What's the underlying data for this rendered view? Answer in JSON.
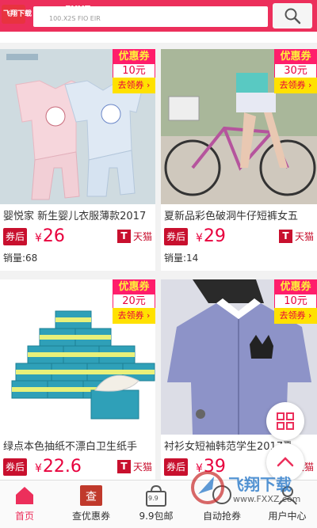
{
  "header": {
    "logo_text": "飞翔下载",
    "site_url": "www.FXXZ.com",
    "search_placeholder": "100.X2S FIO EIR",
    "search_icon": "search-icon"
  },
  "products": [
    {
      "title": "婴悦家 新生婴儿衣服薄款2017",
      "after_coupon_label": "券后",
      "currency": "¥",
      "price": "26",
      "platform": "天猫",
      "platform_icon_letter": "T",
      "sales": "销量:68",
      "coupon": {
        "label": "优惠券",
        "amount": "10元",
        "action": "去领券 ›"
      }
    },
    {
      "title": "夏新品彩色破洞牛仔短裤女五",
      "after_coupon_label": "券后",
      "currency": "¥",
      "price": "29",
      "platform": "天猫",
      "platform_icon_letter": "T",
      "sales": "销量:14",
      "coupon": {
        "label": "优惠券",
        "amount": "30元",
        "action": "去领券 ›"
      }
    },
    {
      "title": "绿点本色抽纸不漂白卫生纸手",
      "after_coupon_label": "券后",
      "currency": "¥",
      "price": "22.6",
      "platform": "天猫",
      "platform_icon_letter": "T",
      "coupon": {
        "label": "优惠券",
        "amount": "20元",
        "action": "去领券 ›"
      }
    },
    {
      "title": "衬衫女短袖韩范学生2017夏装",
      "after_coupon_label": "券后",
      "currency": "¥",
      "price": "39",
      "platform": "天猫",
      "platform_icon_letter": "T",
      "coupon": {
        "label": "优惠券",
        "amount": "10元",
        "action": "去领券 ›"
      }
    }
  ],
  "bottom_nav": [
    {
      "label": "首页",
      "icon": "home-icon",
      "active": true
    },
    {
      "label": "查优惠券",
      "icon": "coupon-search-icon"
    },
    {
      "label": "9.9包邮",
      "icon": "bag-icon",
      "badge": "9.9"
    },
    {
      "label": "自动抢券",
      "icon": "auto-grab-icon"
    },
    {
      "label": "用户中心",
      "icon": "user-icon"
    }
  ],
  "watermark": {
    "text": "飞翔下载",
    "url": "www.FXXZ.com"
  },
  "colors": {
    "brand": "#ec2f5b",
    "price": "#e8003d",
    "coupon_yellow": "#ffe100"
  }
}
